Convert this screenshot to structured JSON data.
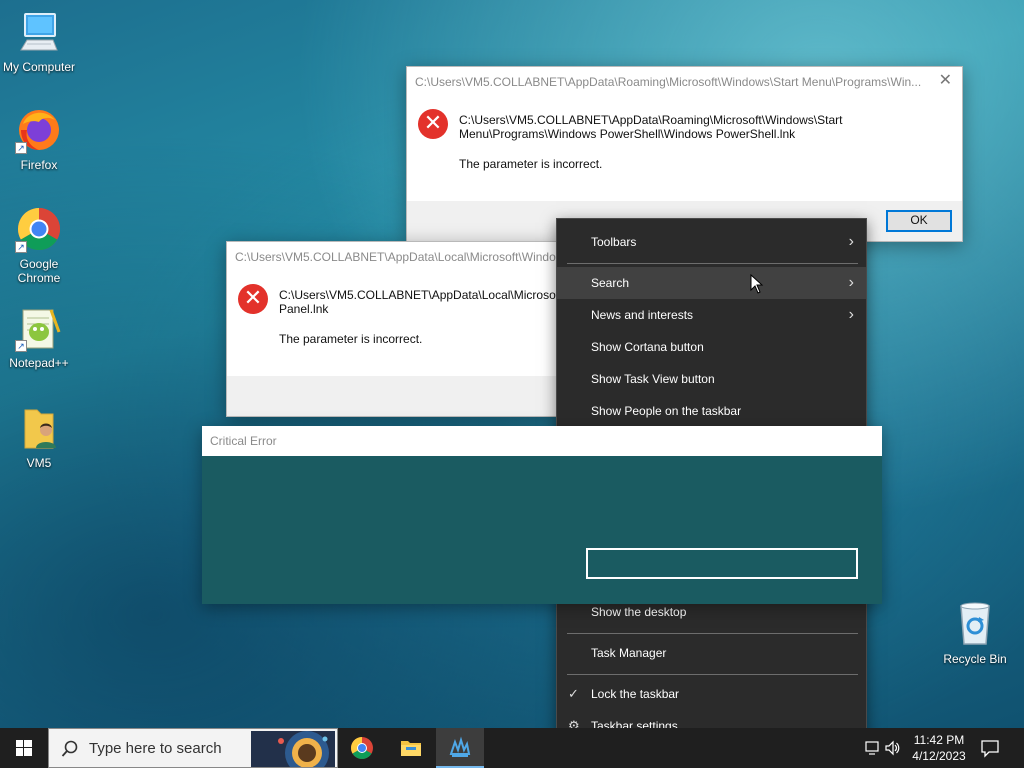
{
  "desktop": {
    "icons": [
      {
        "label": "My Computer",
        "icon": "computer-icon"
      },
      {
        "label": "Firefox",
        "icon": "firefox-icon"
      },
      {
        "label": "Google Chrome",
        "icon": "chrome-icon"
      },
      {
        "label": "Notepad++",
        "icon": "notepad-plus-plus-icon"
      },
      {
        "label": "VM5",
        "icon": "user-folder-icon"
      },
      {
        "label": "Recycle Bin",
        "icon": "recycle-bin-icon"
      }
    ]
  },
  "dialog1": {
    "title": "C:\\Users\\VM5.COLLABNET\\AppData\\Roaming\\Microsoft\\Windows\\Start Menu\\Programs\\Win...",
    "close": "✕",
    "message_line1": "C:\\Users\\VM5.COLLABNET\\AppData\\Roaming\\Microsoft\\Windows\\Start",
    "message_line2": "Menu\\Programs\\Windows PowerShell\\Windows PowerShell.lnk",
    "message_error": "The parameter is incorrect.",
    "ok_label": "OK"
  },
  "dialog2": {
    "title": "C:\\Users\\VM5.COLLABNET\\AppData\\Local\\Microsoft\\Windo",
    "message_line1": "C:\\Users\\VM5.COLLABNET\\AppData\\Local\\Microsof",
    "message_line2": "Panel.lnk",
    "message_error": "The parameter is incorrect."
  },
  "critical": {
    "title": "Critical Error"
  },
  "context_menu": {
    "items": [
      {
        "label": "Toolbars",
        "submenu": true
      },
      {
        "label": "Search",
        "submenu": true
      },
      {
        "label": "News and interests",
        "submenu": true
      },
      {
        "label": "Show Cortana button"
      },
      {
        "label": "Show Task View button"
      },
      {
        "label": "Show People on the taskbar"
      },
      {
        "label": "Show the desktop"
      },
      {
        "label": "Task Manager"
      },
      {
        "label": "Lock the taskbar",
        "checked": true
      },
      {
        "label": "Taskbar settings",
        "icon": "gear-icon"
      }
    ],
    "submenu_arrow": "›",
    "check_mark": "✓",
    "gear_glyph": "⚙"
  },
  "taskbar": {
    "search_placeholder": "Type here to search",
    "time": "11:42 PM",
    "date": "4/12/2023",
    "apps": [
      "chrome-icon",
      "file-explorer-icon",
      "app-icon"
    ]
  },
  "colors": {
    "error_red": "#e3322b",
    "accent_blue": "#0078d7",
    "critical_bg": "#1a5b61",
    "menu_bg": "#2b2b2b"
  }
}
